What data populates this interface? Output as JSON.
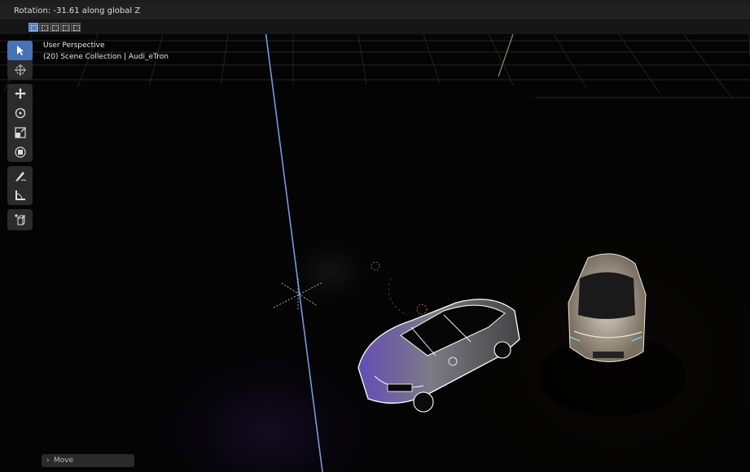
{
  "header": {
    "status_text": "Rotation: -31.61 along global Z"
  },
  "mode_buttons": [
    {
      "name": "select-new-mode-icon",
      "active": true
    },
    {
      "name": "select-extend-mode-icon",
      "active": false
    },
    {
      "name": "select-subtract-mode-icon",
      "active": false
    },
    {
      "name": "select-invert-mode-icon",
      "active": false
    },
    {
      "name": "select-intersect-mode-icon",
      "active": false
    }
  ],
  "viewport": {
    "perspective_label": "User Perspective",
    "collection_label": "(20) Scene Collection | Audi_eTron"
  },
  "tools": [
    {
      "name": "select-box-tool-icon",
      "active": true
    },
    {
      "name": "cursor-tool-icon",
      "active": false
    },
    {
      "name": "move-tool-icon",
      "active": false
    },
    {
      "name": "rotate-tool-icon",
      "active": false
    },
    {
      "name": "scale-tool-icon",
      "active": false
    },
    {
      "name": "transform-tool-icon",
      "active": false
    },
    {
      "name": "annotate-tool-icon",
      "active": false
    },
    {
      "name": "measure-tool-icon",
      "active": false
    },
    {
      "name": "add-cube-tool-icon",
      "active": false
    }
  ],
  "last_operator": {
    "label": "Move"
  },
  "colors": {
    "accent": "#4772b3",
    "panel": "#2b2b2b",
    "grid": "#3a3a3a",
    "wire_outline": "#ffffff",
    "axis_line": "#6f8fd8"
  }
}
